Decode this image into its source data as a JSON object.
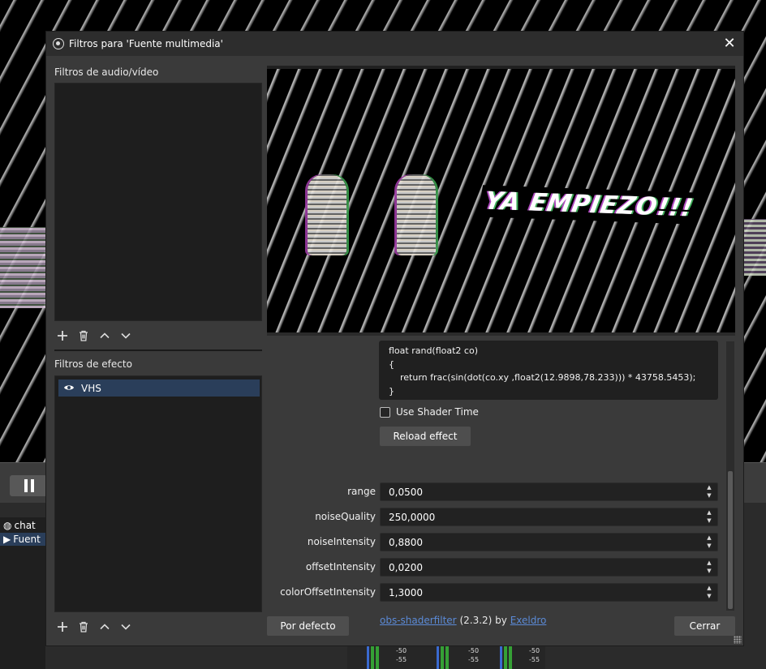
{
  "dialog": {
    "title": "Filtros para 'Fuente multimedia'",
    "close_glyph": "✕"
  },
  "audio_video": {
    "label": "Filtros de audio/vídeo",
    "items": []
  },
  "effects": {
    "label": "Filtros de efecto",
    "items": [
      {
        "label": "VHS",
        "icon": "eye-icon",
        "selected": true
      }
    ]
  },
  "preview": {
    "overlay_text": "YA EMPIEZO!!!"
  },
  "properties": {
    "code_lines": [
      "float rand(float2 co)",
      "{",
      "    return frac(sin(dot(co.xy ,float2(12.9898,78.233))) * 43758.5453);",
      "}"
    ],
    "use_shader_time_label": "Use Shader Time",
    "use_shader_time_checked": false,
    "reload_label": "Reload effect",
    "params": [
      {
        "label": "range",
        "value": "0,0500"
      },
      {
        "label": "noiseQuality",
        "value": "250,0000"
      },
      {
        "label": "noiseIntensity",
        "value": "0,8800"
      },
      {
        "label": "offsetIntensity",
        "value": "0,0200"
      },
      {
        "label": "colorOffsetIntensity",
        "value": "1,3000"
      }
    ],
    "credit_link": "obs-shaderfilter",
    "credit_version": "(2.3.2) by",
    "credit_author": "Exeldro"
  },
  "footer": {
    "defaults_label": "Por defecto",
    "close_label": "Cerrar"
  },
  "background": {
    "sources": [
      {
        "label": "chat",
        "icon": "browser-icon"
      },
      {
        "label": "Fuent",
        "icon": "play-icon",
        "selected": true
      }
    ],
    "meter_labels": [
      "-50",
      "-55"
    ]
  }
}
